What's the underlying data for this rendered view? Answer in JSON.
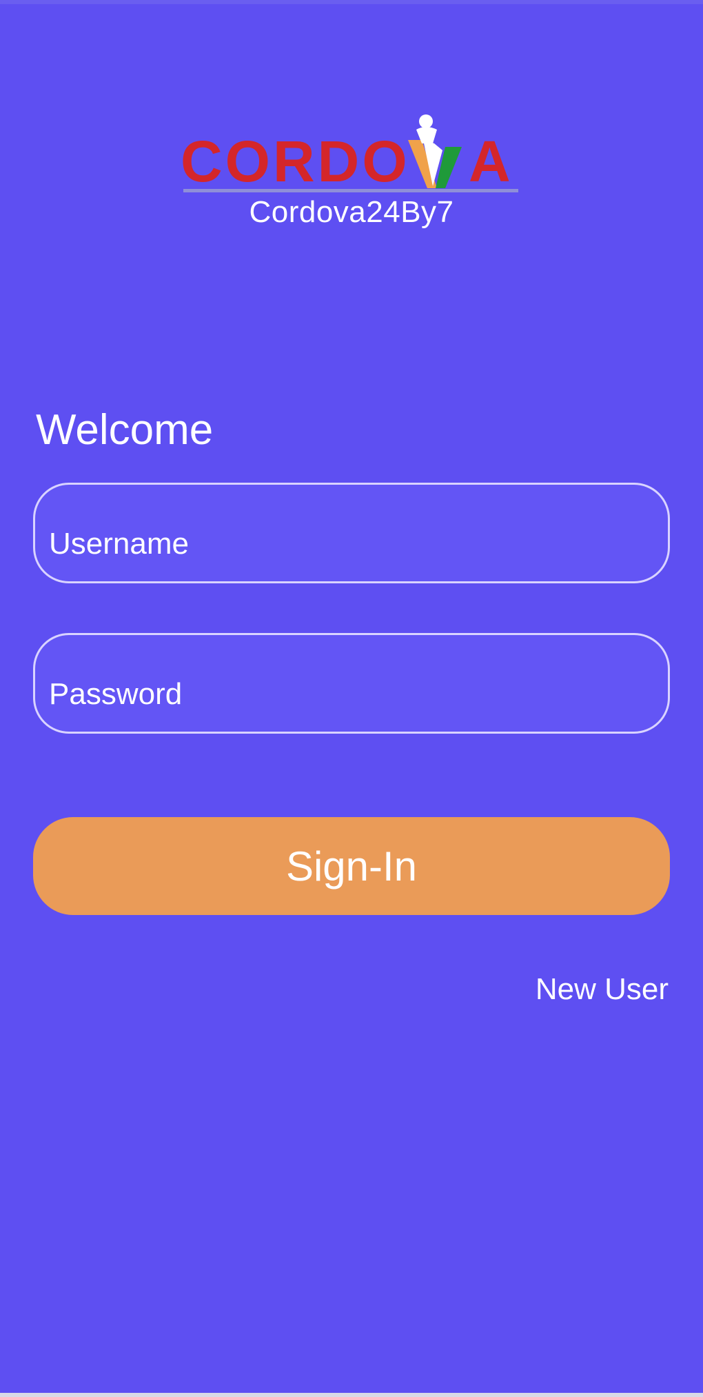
{
  "logo": {
    "brand_letters_left": "CORDO",
    "brand_letter_right": "A",
    "subtitle": "Cordova24By7",
    "colors": {
      "text_red": "#d4262a",
      "underline": "#8f8fd8",
      "saffron": "#f0a24a",
      "green": "#1f9a3a",
      "white": "#ffffff"
    }
  },
  "login": {
    "welcome": "Welcome",
    "username_placeholder": "Username",
    "password_placeholder": "Password",
    "signin_label": "Sign-In",
    "new_user_label": "New User"
  },
  "theme": {
    "background": "#5e4ff2",
    "button": "#ea9b58"
  }
}
